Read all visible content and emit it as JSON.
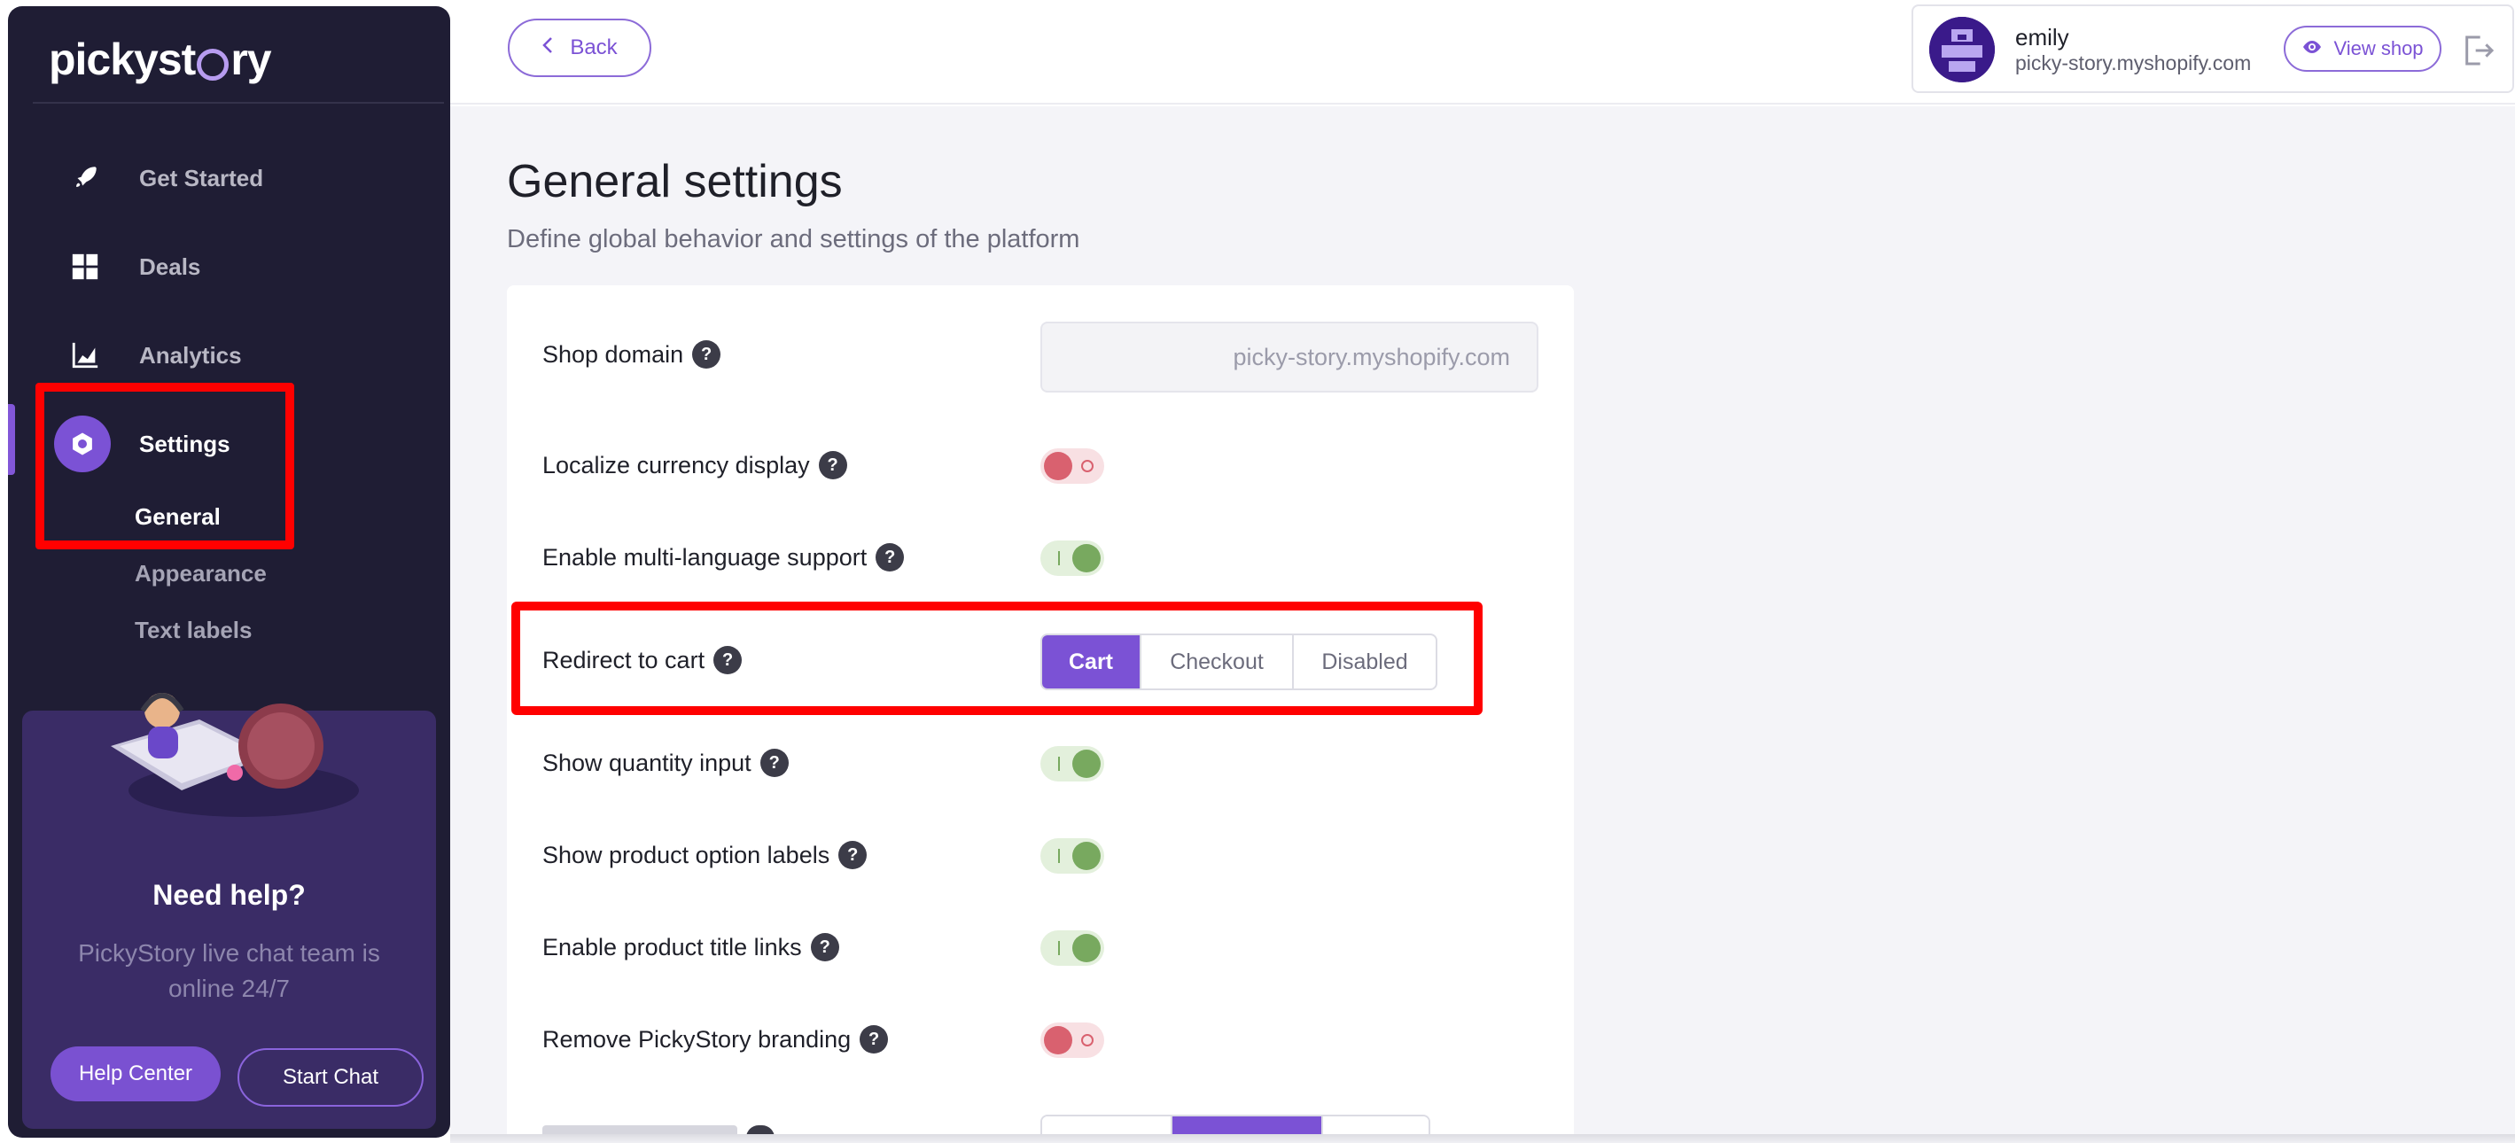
{
  "logo": {
    "text_before": "pickyst",
    "text_after": "ry"
  },
  "sidebar": {
    "items": [
      {
        "label": "Get Started",
        "icon": "rocket-icon"
      },
      {
        "label": "Deals",
        "icon": "grid-icon"
      },
      {
        "label": "Analytics",
        "icon": "chart-icon"
      },
      {
        "label": "Settings",
        "icon": "gear-icon"
      }
    ],
    "subitems": [
      {
        "label": "General"
      },
      {
        "label": "Appearance"
      },
      {
        "label": "Text labels"
      }
    ],
    "help": {
      "title": "Need help?",
      "text": "PickyStory live chat team is online 24/7",
      "help_center": "Help Center",
      "start_chat": "Start Chat"
    }
  },
  "topbar": {
    "back": "Back",
    "account": {
      "name": "emily",
      "domain": "picky-story.myshopify.com"
    },
    "view_shop": "View shop"
  },
  "page": {
    "title": "General settings",
    "subtitle": "Define global behavior and settings of the platform"
  },
  "settings": {
    "shop_domain": {
      "label": "Shop domain",
      "value": "picky-story.myshopify.com"
    },
    "localize_currency": {
      "label": "Localize currency display",
      "enabled": false
    },
    "multi_language": {
      "label": "Enable multi-language support",
      "enabled": true
    },
    "redirect": {
      "label": "Redirect to cart",
      "options": [
        "Cart",
        "Checkout",
        "Disabled"
      ],
      "selected": "Cart"
    },
    "quantity_input": {
      "label": "Show quantity input",
      "enabled": true
    },
    "option_labels": {
      "label": "Show product option labels",
      "enabled": true
    },
    "title_links": {
      "label": "Enable product title links",
      "enabled": true
    },
    "remove_branding": {
      "label": "Remove PickyStory branding",
      "enabled": false
    }
  },
  "help_glyph": "?",
  "colors": {
    "accent": "#7b52d5",
    "sidebar_bg": "#1f1d34",
    "toggle_on": "#78a95f",
    "toggle_off": "#d9616f",
    "annotation": "#ff0000"
  }
}
